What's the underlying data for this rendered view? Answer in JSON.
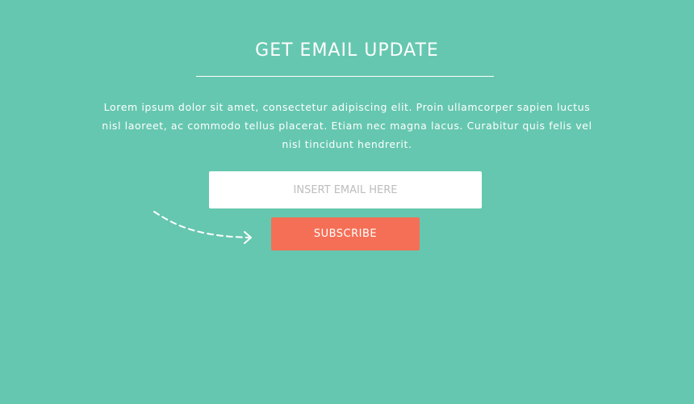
{
  "newsletter": {
    "title": "GET EMAIL UPDATE",
    "description": "Lorem ipsum dolor sit amet, consectetur adipiscing elit. Proin ullamcorper sapien luctus nisl laoreet, ac commodo tellus placerat. Etiam nec magna lacus. Curabitur quis felis vel nisl tincidunt hendrerit.",
    "email_value": "",
    "email_placeholder": "INSERT EMAIL HERE",
    "subscribe_label": "SUBSCRIBE"
  },
  "icons": {
    "arrow": "dashed-curved-arrow-icon"
  },
  "colors": {
    "background": "#66c7b0",
    "button": "#f56f56",
    "input_background": "#ffffff",
    "text": "#ffffff"
  }
}
